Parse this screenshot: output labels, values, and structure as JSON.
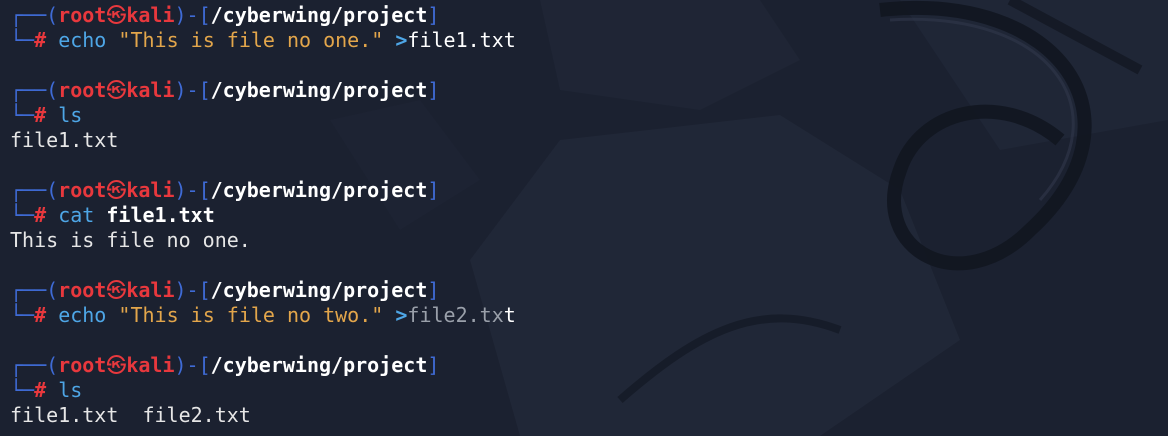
{
  "prompt": {
    "open_bracket": "┌──(",
    "user": "root",
    "skull": "㉿",
    "host": "kali",
    "mid": ")-[",
    "path": "/cyberwing/project",
    "close_bracket": "]",
    "corner": "└─",
    "hash": "# "
  },
  "blocks": [
    {
      "command": {
        "name": "echo",
        "string": "\"This is file no one.\"",
        "redir": ">",
        "target": "file1.txt"
      },
      "output": null
    },
    {
      "command": {
        "name": "ls"
      },
      "output": "file1.txt"
    },
    {
      "command": {
        "name": "cat",
        "arg": "file1.txt"
      },
      "output": "This is file no one."
    },
    {
      "command": {
        "name": "echo",
        "string": "\"This is file no two.\"",
        "redir": ">",
        "target_dim": "file2.tx",
        "target_end": "t"
      },
      "output": null
    },
    {
      "command": {
        "name": "ls"
      },
      "output": "file1.txt  file2.txt"
    }
  ]
}
